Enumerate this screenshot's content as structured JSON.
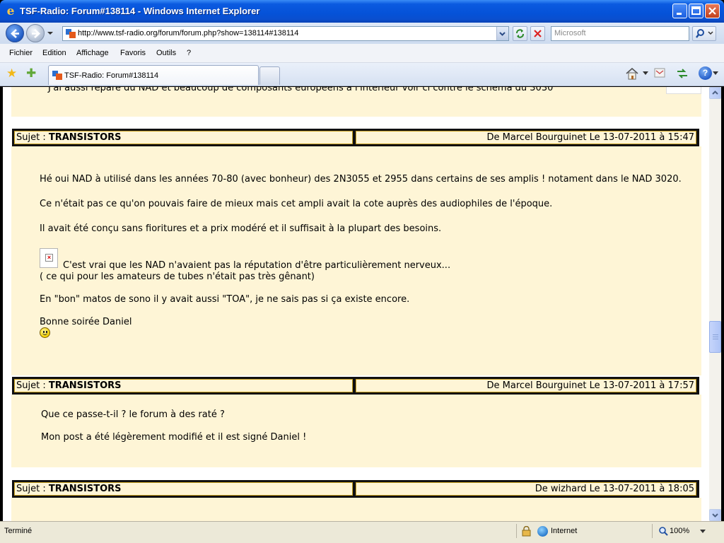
{
  "window": {
    "title": "TSF-Radio: Forum#138114 - Windows Internet Explorer"
  },
  "address_bar": {
    "url": "http://www.tsf-radio.org/forum/forum.php?show=138114#138114",
    "search_placeholder": "Microsoft"
  },
  "menu": {
    "items": [
      "Fichier",
      "Edition",
      "Affichage",
      "Favoris",
      "Outils",
      "?"
    ]
  },
  "tabs": {
    "active_title": "TSF-Radio: Forum#138114"
  },
  "page": {
    "cut_off_text": "J'ai aussi réparé du NAD et beaucoup de composants européens à l'intérieur voir ci contre le schéma du 3030",
    "posts": [
      {
        "subject_label": "Sujet : ",
        "subject": "TRANSISTORS",
        "meta": "De Marcel Bourguinet  Le 13-07-2011 à 15:47",
        "lines": [
          "Hé oui NAD à utilisé dans les années 70-80 (avec bonheur) des 2N3055 et 2955 dans certains de ses amplis ! notament dans le NAD 3020.",
          "Ce n'était pas ce qu'on pouvais faire de mieux mais cet ampli avait la cote auprès des audiophiles de l'époque.",
          "Il avait été conçu sans fioritures et a prix modéré et il suffisait à la plupart des besoins.",
          "C'est vrai que les NAD n'avaient pas la réputation d'être particulièrement nerveux...",
          "( ce qui pour les amateurs de tubes n'était pas très gênant)",
          "En \"bon\" matos de sono il y avait aussi \"TOA\", je ne sais pas si ça existe encore.",
          "Bonne soirée Daniel"
        ]
      },
      {
        "subject_label": "Sujet : ",
        "subject": "TRANSISTORS",
        "meta": "De Marcel Bourguinet  Le 13-07-2011 à 17:57",
        "lines": [
          "Que ce passe-t-il ? le forum à des raté ?",
          "Mon post a été légèrement modifié et il est signé Daniel !"
        ]
      },
      {
        "subject_label": "Sujet : ",
        "subject": "TRANSISTORS",
        "meta": "De wizhard  Le 13-07-2011 à 18:05",
        "lines": []
      }
    ]
  },
  "status_bar": {
    "text": "Terminé",
    "zone": "Internet",
    "zoom": "100%"
  },
  "colors": {
    "post_background": "#fef5d6",
    "header_border": "#c8a020",
    "titlebar_blue": "#0552d8"
  },
  "icons": {
    "title": "ie-logo-icon",
    "back": "back-arrow-icon",
    "forward": "forward-arrow-icon",
    "refresh": "refresh-icon",
    "stop": "stop-icon",
    "search": "search-icon",
    "favorites": "favorites-star-icon",
    "add_favorites": "add-favorites-icon",
    "home": "home-icon",
    "feeds": "feeds-icon",
    "tools": "tools-icon",
    "help": "help-icon",
    "broken_image": "broken-image-icon",
    "smiley": "smiley-icon",
    "globe": "globe-icon",
    "lock": "security-lock-icon",
    "zoom": "zoom-icon"
  }
}
